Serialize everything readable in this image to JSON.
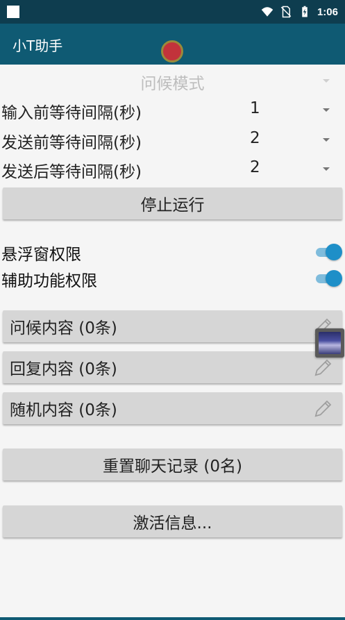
{
  "status_bar": {
    "time": "1:06",
    "icons": [
      "square-notification-icon",
      "wifi-icon",
      "no-sim-icon",
      "battery-charging-icon"
    ]
  },
  "app_bar": {
    "title": "小T助手",
    "record_indicator_color": "#c2333b"
  },
  "settings": {
    "mode_spinner": "问候模式",
    "rows": [
      {
        "label": "输入前等待间隔(秒)",
        "value": "1"
      },
      {
        "label": "发送前等待间隔(秒)",
        "value": "2"
      },
      {
        "label": "发送后等待间隔(秒)",
        "value": "2"
      }
    ]
  },
  "buttons": {
    "stop": "停止运行",
    "reset_chat": "重置聊天记录 (0名)",
    "activation": "激活信息..."
  },
  "permissions": {
    "overlay": {
      "label": "悬浮窗权限",
      "enabled": true
    },
    "accessibility": {
      "label": "辅助功能权限",
      "enabled": true
    }
  },
  "content_lists": [
    {
      "label": "问候内容 (0条)"
    },
    {
      "label": "回复内容 (0条)"
    },
    {
      "label": "随机内容 (0条)"
    }
  ],
  "colors": {
    "status_bar": "#0e3d4f",
    "app_bar": "#0f5a73",
    "switch_on": "#1e8fc8"
  }
}
